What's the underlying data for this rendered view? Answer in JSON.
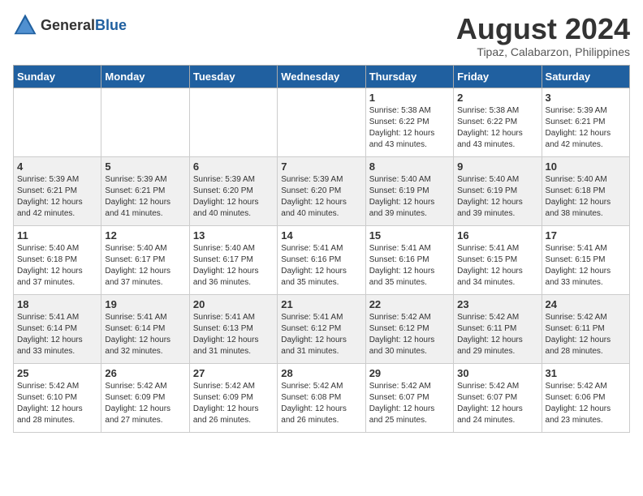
{
  "header": {
    "logo": {
      "general": "General",
      "blue": "Blue"
    },
    "title": "August 2024",
    "location": "Tipaz, Calabarzon, Philippines"
  },
  "days_of_week": [
    "Sunday",
    "Monday",
    "Tuesday",
    "Wednesday",
    "Thursday",
    "Friday",
    "Saturday"
  ],
  "weeks": [
    [
      {
        "day": "",
        "info": ""
      },
      {
        "day": "",
        "info": ""
      },
      {
        "day": "",
        "info": ""
      },
      {
        "day": "",
        "info": ""
      },
      {
        "day": "1",
        "info": "Sunrise: 5:38 AM\nSunset: 6:22 PM\nDaylight: 12 hours\nand 43 minutes."
      },
      {
        "day": "2",
        "info": "Sunrise: 5:38 AM\nSunset: 6:22 PM\nDaylight: 12 hours\nand 43 minutes."
      },
      {
        "day": "3",
        "info": "Sunrise: 5:39 AM\nSunset: 6:21 PM\nDaylight: 12 hours\nand 42 minutes."
      }
    ],
    [
      {
        "day": "4",
        "info": "Sunrise: 5:39 AM\nSunset: 6:21 PM\nDaylight: 12 hours\nand 42 minutes."
      },
      {
        "day": "5",
        "info": "Sunrise: 5:39 AM\nSunset: 6:21 PM\nDaylight: 12 hours\nand 41 minutes."
      },
      {
        "day": "6",
        "info": "Sunrise: 5:39 AM\nSunset: 6:20 PM\nDaylight: 12 hours\nand 40 minutes."
      },
      {
        "day": "7",
        "info": "Sunrise: 5:39 AM\nSunset: 6:20 PM\nDaylight: 12 hours\nand 40 minutes."
      },
      {
        "day": "8",
        "info": "Sunrise: 5:40 AM\nSunset: 6:19 PM\nDaylight: 12 hours\nand 39 minutes."
      },
      {
        "day": "9",
        "info": "Sunrise: 5:40 AM\nSunset: 6:19 PM\nDaylight: 12 hours\nand 39 minutes."
      },
      {
        "day": "10",
        "info": "Sunrise: 5:40 AM\nSunset: 6:18 PM\nDaylight: 12 hours\nand 38 minutes."
      }
    ],
    [
      {
        "day": "11",
        "info": "Sunrise: 5:40 AM\nSunset: 6:18 PM\nDaylight: 12 hours\nand 37 minutes."
      },
      {
        "day": "12",
        "info": "Sunrise: 5:40 AM\nSunset: 6:17 PM\nDaylight: 12 hours\nand 37 minutes."
      },
      {
        "day": "13",
        "info": "Sunrise: 5:40 AM\nSunset: 6:17 PM\nDaylight: 12 hours\nand 36 minutes."
      },
      {
        "day": "14",
        "info": "Sunrise: 5:41 AM\nSunset: 6:16 PM\nDaylight: 12 hours\nand 35 minutes."
      },
      {
        "day": "15",
        "info": "Sunrise: 5:41 AM\nSunset: 6:16 PM\nDaylight: 12 hours\nand 35 minutes."
      },
      {
        "day": "16",
        "info": "Sunrise: 5:41 AM\nSunset: 6:15 PM\nDaylight: 12 hours\nand 34 minutes."
      },
      {
        "day": "17",
        "info": "Sunrise: 5:41 AM\nSunset: 6:15 PM\nDaylight: 12 hours\nand 33 minutes."
      }
    ],
    [
      {
        "day": "18",
        "info": "Sunrise: 5:41 AM\nSunset: 6:14 PM\nDaylight: 12 hours\nand 33 minutes."
      },
      {
        "day": "19",
        "info": "Sunrise: 5:41 AM\nSunset: 6:14 PM\nDaylight: 12 hours\nand 32 minutes."
      },
      {
        "day": "20",
        "info": "Sunrise: 5:41 AM\nSunset: 6:13 PM\nDaylight: 12 hours\nand 31 minutes."
      },
      {
        "day": "21",
        "info": "Sunrise: 5:41 AM\nSunset: 6:12 PM\nDaylight: 12 hours\nand 31 minutes."
      },
      {
        "day": "22",
        "info": "Sunrise: 5:42 AM\nSunset: 6:12 PM\nDaylight: 12 hours\nand 30 minutes."
      },
      {
        "day": "23",
        "info": "Sunrise: 5:42 AM\nSunset: 6:11 PM\nDaylight: 12 hours\nand 29 minutes."
      },
      {
        "day": "24",
        "info": "Sunrise: 5:42 AM\nSunset: 6:11 PM\nDaylight: 12 hours\nand 28 minutes."
      }
    ],
    [
      {
        "day": "25",
        "info": "Sunrise: 5:42 AM\nSunset: 6:10 PM\nDaylight: 12 hours\nand 28 minutes."
      },
      {
        "day": "26",
        "info": "Sunrise: 5:42 AM\nSunset: 6:09 PM\nDaylight: 12 hours\nand 27 minutes."
      },
      {
        "day": "27",
        "info": "Sunrise: 5:42 AM\nSunset: 6:09 PM\nDaylight: 12 hours\nand 26 minutes."
      },
      {
        "day": "28",
        "info": "Sunrise: 5:42 AM\nSunset: 6:08 PM\nDaylight: 12 hours\nand 26 minutes."
      },
      {
        "day": "29",
        "info": "Sunrise: 5:42 AM\nSunset: 6:07 PM\nDaylight: 12 hours\nand 25 minutes."
      },
      {
        "day": "30",
        "info": "Sunrise: 5:42 AM\nSunset: 6:07 PM\nDaylight: 12 hours\nand 24 minutes."
      },
      {
        "day": "31",
        "info": "Sunrise: 5:42 AM\nSunset: 6:06 PM\nDaylight: 12 hours\nand 23 minutes."
      }
    ]
  ]
}
